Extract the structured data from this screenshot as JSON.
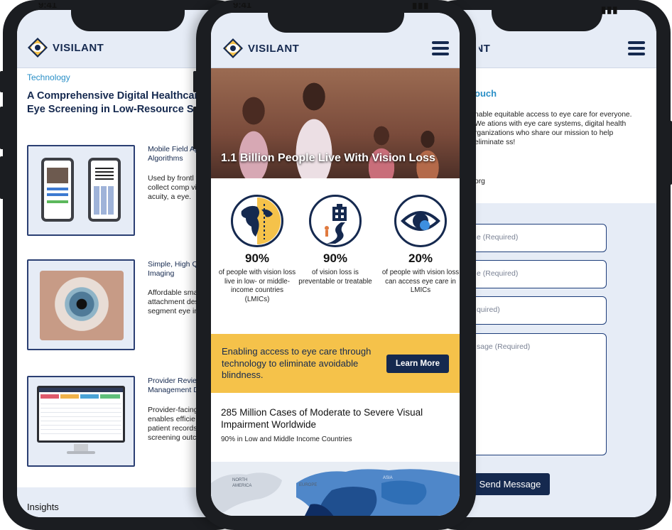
{
  "brand": {
    "name": "VISILANT"
  },
  "status": {
    "time": "9:41"
  },
  "left_phone": {
    "category": "Technology",
    "title": "A Comprehensive Digital Healthcare So Eye Screening in Low-Resource Setting",
    "features": [
      {
        "title": "Mobile Field Ap Algorithms",
        "desc": "Used by frontl to collect comp visual acuity, a eye."
      },
      {
        "title": "Simple, High Q Imaging",
        "desc": "Affordable sma attachment des segment eye in"
      },
      {
        "title": "Provider Review Management D",
        "desc": "Provider-facing enables efficie patient records screening outco"
      }
    ],
    "insights": "Insights"
  },
  "center_phone": {
    "hero_caption": "1.1 Billion People Live With Vision Loss",
    "stats": [
      {
        "value": "90%",
        "desc": "of people with vision loss live in low- or middle-income countries (LMICs)",
        "icon": "globe-icon"
      },
      {
        "value": "90%",
        "desc": "of vision loss is preventable or treatable",
        "icon": "path-to-clinic-icon"
      },
      {
        "value": "20%",
        "desc": "of people with vision loss can access eye care in LMICs",
        "icon": "eye-icon"
      }
    ],
    "banner_text": "Enabling access to eye care through technology to eliminate avoidable blindness.",
    "learn_more": "Learn More",
    "cases_title": "285 Million Cases of Moderate to Severe Visual Impairment Worldwide",
    "cases_sub": "90% in Low and Middle Income Countries",
    "map_labels": {
      "north_america": "NORTH AMERICA",
      "europe": "EUROPE",
      "asia": "ASIA"
    }
  },
  "right_phone": {
    "heading": "ouch",
    "paragraph": "nable equitable access to eye care for everyone. We ations with eye care systems, digital health rganizations who share our mission to help eliminate ss!",
    "org": "org",
    "fields": [
      {
        "placeholder": "e (Required)"
      },
      {
        "placeholder": "e (Required)"
      },
      {
        "placeholder": "quired)"
      },
      {
        "placeholder": "sage (Required)"
      }
    ],
    "send": "Send Message"
  },
  "colors": {
    "navy": "#15294f",
    "accent": "#f5c24a",
    "link": "#2a8fc7",
    "panel": "#e6ecf6"
  }
}
